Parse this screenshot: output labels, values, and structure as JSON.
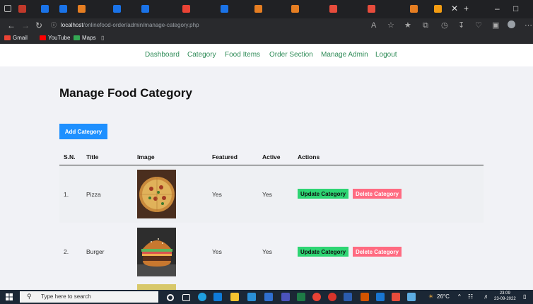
{
  "browser": {
    "url_host": "localhost",
    "url_path": "/onlinefood-order/admin/manage-category.php",
    "close_tab_glyph": "✕",
    "new_tab_glyph": "+",
    "bookmarks": [
      {
        "label": "Gmail",
        "icon": "gmail-icon",
        "color": "#ea4335"
      },
      {
        "label": "YouTube",
        "icon": "youtube-icon",
        "color": "#ff0000"
      },
      {
        "label": "Maps",
        "icon": "maps-icon",
        "color": "#34a853"
      }
    ]
  },
  "nav": {
    "links": [
      "Dashboard",
      "Category",
      "Food Items",
      "Order Section",
      "Manage Admin",
      "Logout"
    ]
  },
  "main": {
    "title": "Manage Food Category",
    "add_button": "Add Category",
    "columns": [
      "S.N.",
      "Title",
      "Image",
      "Featured",
      "Active",
      "Actions"
    ],
    "rows": [
      {
        "sn": "1.",
        "title": "Pizza",
        "image": "pizza-image",
        "featured": "Yes",
        "active": "Yes",
        "update": "Update Category",
        "delete": "Delete Category"
      },
      {
        "sn": "2.",
        "title": "Burger",
        "image": "burger-image",
        "featured": "Yes",
        "active": "Yes",
        "update": "Update Category",
        "delete": "Delete Category"
      }
    ]
  },
  "taskbar": {
    "search_placeholder": "Type here to search",
    "temperature": "26°C",
    "time": "23:09",
    "date": "23-09-2022"
  },
  "colors": {
    "nav_link": "#2e8b57",
    "add_button": "#1e90ff",
    "update_button": "#2ed573",
    "delete_button": "#ff6b81",
    "content_bg": "#f1f2f6"
  }
}
